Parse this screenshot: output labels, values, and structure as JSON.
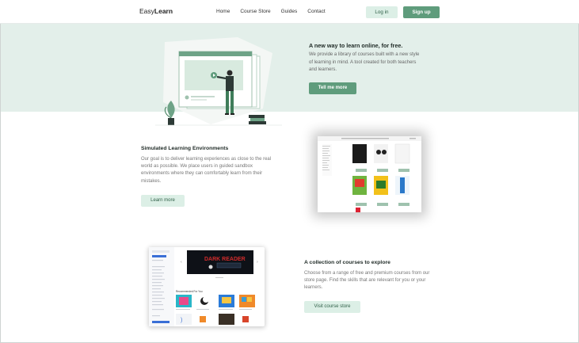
{
  "nav": {
    "logo_prefix": "Easy",
    "logo_bold": "Learn",
    "links": [
      "Home",
      "Course Store",
      "Guides",
      "Contact"
    ],
    "login_label": "Log in",
    "signup_label": "Sign up"
  },
  "hero": {
    "title": "A new way to learn online, for free.",
    "text": "We provide a library of courses built with a new style of learning in mind. A tool created for both teachers and learners.",
    "button_label": "Tell me more"
  },
  "section2": {
    "title": "Simulated Learning Environments",
    "text": "Our goal is to deliver learning experiences as close to the real world as possible. We place users in guided sandbox environments where they can comfortably learn from their mistakes.",
    "button_label": "Learn more"
  },
  "section3": {
    "title": "A collection of courses to explore",
    "text": "Choose from a range of free and premium courses from our store page. Find the skills that are relevant for you or your learners.",
    "button_label": "Visit course store",
    "preview_banner": "DARK READER",
    "preview_heading": "Recommended For You"
  },
  "colors": {
    "accent": "#5f9c7c",
    "accent_light": "#dcefe6",
    "hero_bg": "#e3efea"
  }
}
